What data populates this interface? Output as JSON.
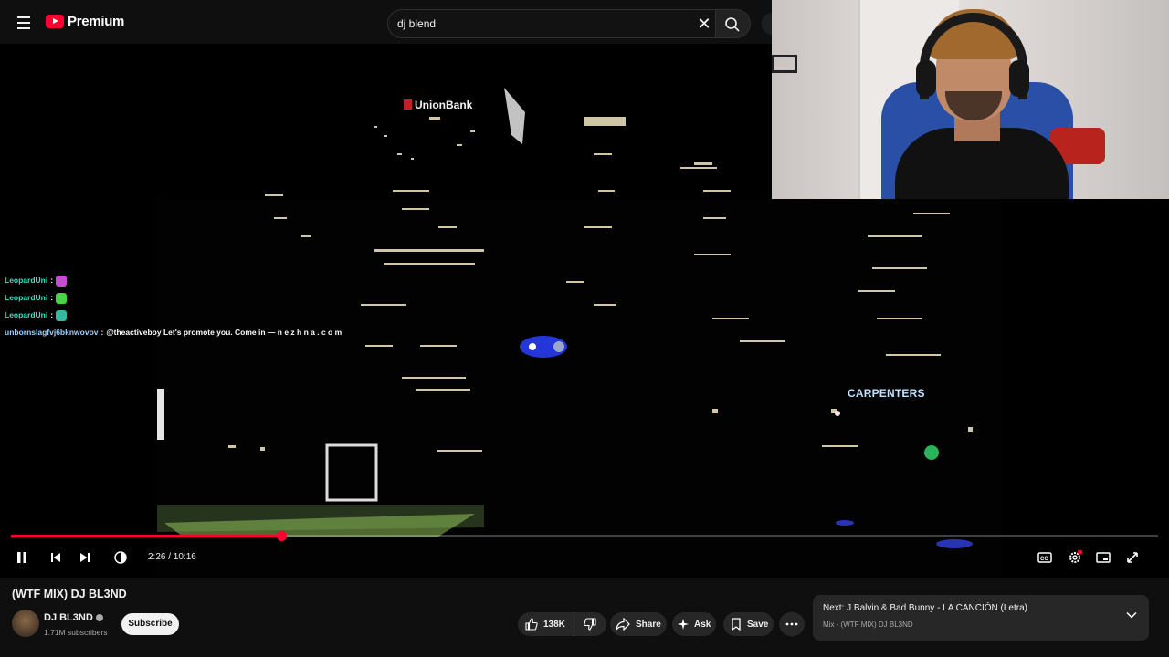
{
  "topbar": {
    "logo_text": "Premium",
    "search_value": "dj blend"
  },
  "video": {
    "signs": {
      "union_bank": "UnionBank",
      "carpenters": "CARPENTERS"
    },
    "chat": [
      {
        "user": "LeopardUni",
        "sep": ":",
        "message": "",
        "emote_color": "#c84bd6"
      },
      {
        "user": "LeopardUni",
        "sep": ":",
        "message": "",
        "emote_color": "#49d24a"
      },
      {
        "user": "LeopardUni",
        "sep": ":",
        "message": "",
        "emote_color": "#35b9a0"
      },
      {
        "user": "unbornslagfvj6bknwovov",
        "sep": ":",
        "message": "@theactiveboy Let's promote you. Come in — n e z h n a . c o m"
      }
    ]
  },
  "player": {
    "progress": 0.236,
    "time": "2:26 / 10:16"
  },
  "meta": {
    "title": "(WTF MIX) DJ BL3ND",
    "channel_name": "DJ BL3ND",
    "subscribers": "1.71M subscribers",
    "subscribe_label": "Subscribe",
    "like_count": "138K",
    "share_label": "Share",
    "ask_label": "Ask",
    "save_label": "Save"
  },
  "next": {
    "title": "Next: J Balvin & Bad Bunny - LA CANCIÓN (Letra)",
    "subtitle": "Mix - (WTF MIX) DJ BL3ND"
  },
  "colors": {
    "accent": "#ff0033",
    "chat_user": "#3fe0c0"
  }
}
